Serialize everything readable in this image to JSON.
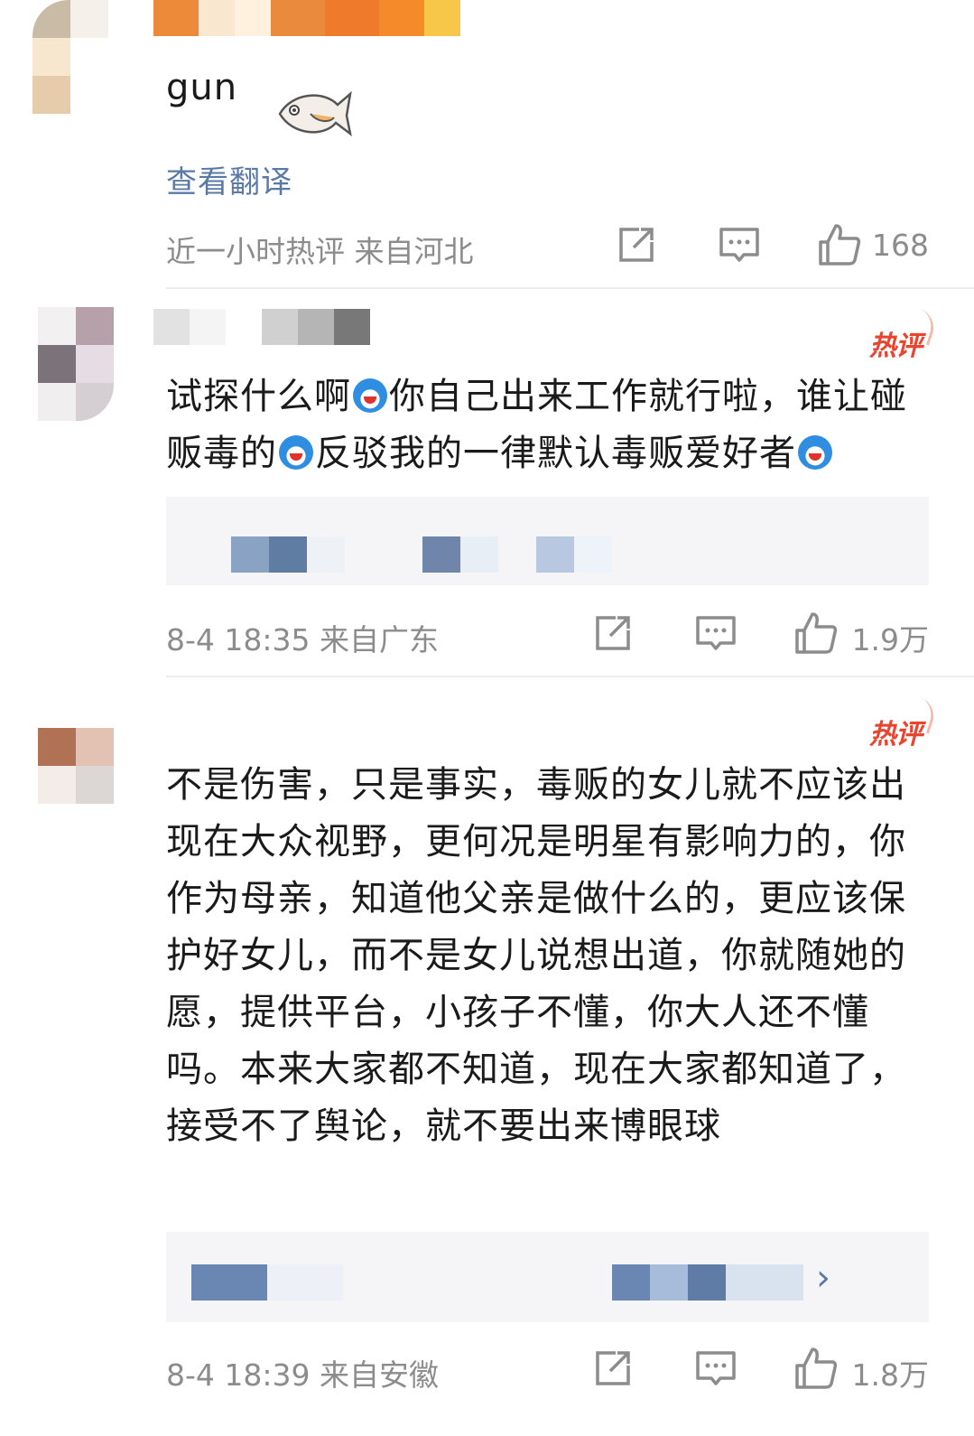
{
  "comments": [
    {
      "text": "gun",
      "translate_label": "查看翻译",
      "meta": "近一小时热评  来自河北",
      "likes": "168",
      "hot": false
    },
    {
      "text_parts": [
        "试探什么啊",
        "你自己出来工作就行啦，谁让碰贩毒的",
        "反驳我的一律默认毒贩爱好者"
      ],
      "meta": "8-4 18:35  来自广东",
      "likes": "1.9万",
      "hot": true,
      "hot_label": "热评"
    },
    {
      "text": "不是伤害，只是事实，毒贩的女儿就不应该出现在大众视野，更何况是明星有影响力的，你作为母亲，知道他父亲是做什么的，更应该保护好女儿，而不是女儿说想出道，你就随她的愿，提供平台，小孩子不懂，你大人还不懂吗。本来大家都不知道，现在大家都知道了，接受不了舆论，就不要出来博眼球",
      "meta": "8-4 18:39  来自安徽",
      "likes": "1.8万",
      "hot": true,
      "hot_label": "热评",
      "reply_arrow": "›"
    }
  ],
  "icons": {
    "share": "share-icon",
    "comment": "comment-icon",
    "like": "thumbs-up-icon",
    "emoji": "doraemon-emoji-icon",
    "fish": "fish-sticker-icon"
  },
  "colors": {
    "hot_badge": "#e8442e",
    "meta_text": "#8c8c8c",
    "translate_link": "#5a7aa6"
  }
}
